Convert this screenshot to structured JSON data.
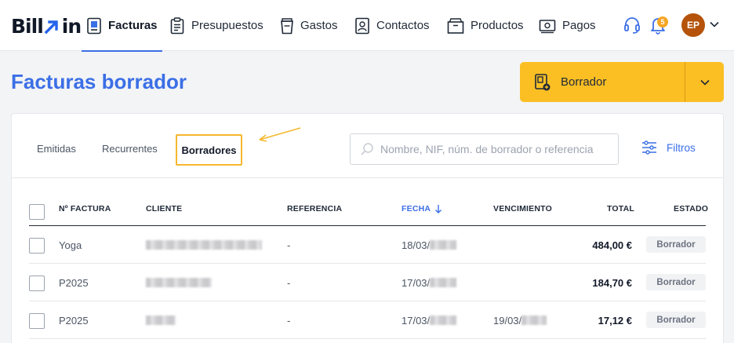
{
  "app": {
    "logo_left": "Bill",
    "logo_right": "in"
  },
  "nav": {
    "items": [
      {
        "label": "Facturas",
        "icon": "invoice-icon",
        "active": true
      },
      {
        "label": "Presupuestos",
        "icon": "clipboard-icon",
        "active": false
      },
      {
        "label": "Gastos",
        "icon": "cup-icon",
        "active": false
      },
      {
        "label": "Contactos",
        "icon": "contact-card-icon",
        "active": false
      },
      {
        "label": "Productos",
        "icon": "box-icon",
        "active": false
      },
      {
        "label": "Pagos",
        "icon": "cash-icon",
        "active": false
      }
    ]
  },
  "header": {
    "notifications_count": "5",
    "avatar_initials": "EP"
  },
  "page": {
    "title": "Facturas borrador"
  },
  "new_button": {
    "label": "Borrador",
    "color": "#fbbf24"
  },
  "tabs": {
    "items": [
      "Emitidas",
      "Recurrentes",
      "Borradores"
    ],
    "active": "Borradores"
  },
  "search": {
    "value": "",
    "placeholder": "Nombre, NIF, núm. de borrador o referencia"
  },
  "filters": {
    "label": "Filtros"
  },
  "table": {
    "columns": {
      "number": "Nº FACTURA",
      "client": "CLIENTE",
      "reference": "REFERENCIA",
      "date": "FECHA",
      "due": "VENCIMIENTO",
      "total": "TOTAL",
      "status": "ESTADO"
    },
    "rows": [
      {
        "number": "Yoga",
        "reference": "-",
        "date": "18/03/",
        "due": "",
        "total": "484,00 €",
        "status": "Borrador"
      },
      {
        "number": "P2025",
        "reference": "-",
        "date": "17/03/",
        "due": "",
        "total": "184,70 €",
        "status": "Borrador"
      },
      {
        "number": "P2025",
        "reference": "-",
        "date": "17/03/",
        "due": "19/03/",
        "total": "17,12 €",
        "status": "Borrador"
      }
    ]
  },
  "colors": {
    "accent": "#3b6fe6",
    "highlight": "#f5b82e"
  }
}
